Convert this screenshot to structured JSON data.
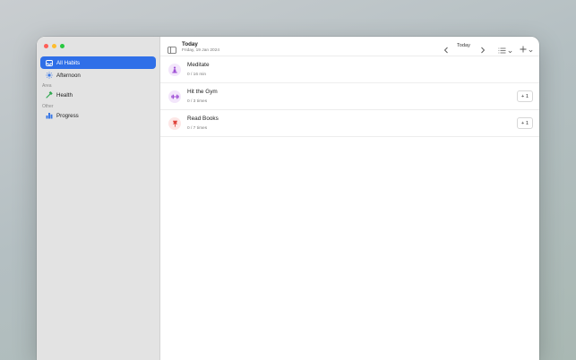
{
  "sidebar": {
    "items": [
      {
        "label": "All Habits",
        "icon": "tray-icon",
        "active": true
      },
      {
        "label": "Afternoon",
        "icon": "sun-icon",
        "active": false
      }
    ],
    "sections": [
      {
        "label": "Area",
        "items": [
          {
            "label": "Health",
            "icon": "hammer-icon"
          }
        ]
      },
      {
        "label": "Other",
        "items": [
          {
            "label": "Progress",
            "icon": "bar-chart-icon"
          }
        ]
      }
    ]
  },
  "toolbar": {
    "title": "Today",
    "subtitle": "Friday, 19 Jan 2024",
    "today_label": "Today"
  },
  "habits": [
    {
      "name": "Meditate",
      "progress": "0 / 16 min",
      "icon": "meditate-icon",
      "color": "#a052d6",
      "bg": "#f3e6fb",
      "increment": null
    },
    {
      "name": "Hit the Gym",
      "progress": "0 / 3 times",
      "icon": "dumbbell-icon",
      "color": "#a052d6",
      "bg": "#f3e6fb",
      "increment": "+ 1"
    },
    {
      "name": "Read Books",
      "progress": "0 / 7 times",
      "icon": "pin-icon",
      "color": "#e0443d",
      "bg": "#fde7e6",
      "increment": "+ 1"
    }
  ],
  "colors": {
    "accent": "#2f6fe8",
    "sidebar_bg": "#e3e3e3"
  }
}
